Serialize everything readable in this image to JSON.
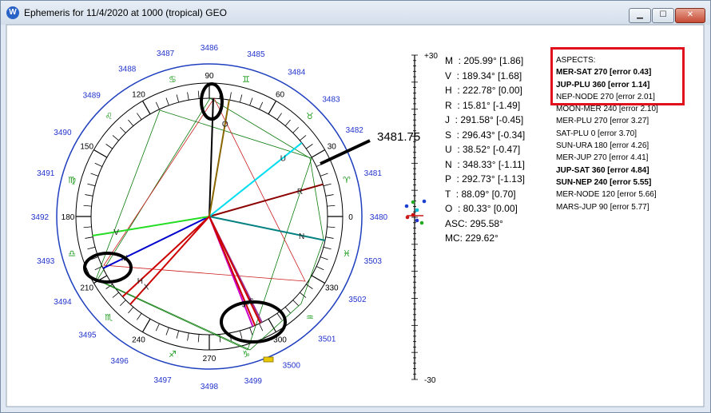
{
  "window": {
    "title": "Ephemeris for 11/4/2020 at 1000 (tropical) GEO",
    "app_icon": "W",
    "buttons": [
      "minimize",
      "maximize",
      "close"
    ]
  },
  "wheel": {
    "year_labels": [
      {
        "label": "3486",
        "angle": 90
      },
      {
        "label": "3485",
        "angle": 74
      },
      {
        "label": "3484",
        "angle": 59
      },
      {
        "label": "3483",
        "angle": 44
      },
      {
        "label": "3482",
        "angle": 31
      },
      {
        "label": "3481",
        "angle": 15
      },
      {
        "label": "3480",
        "angle": 0
      },
      {
        "label": "3503",
        "angle": -15
      },
      {
        "label": "3502",
        "angle": -29
      },
      {
        "label": "3501",
        "angle": -46
      },
      {
        "label": "3500",
        "angle": -61
      },
      {
        "label": "3499",
        "angle": -75
      },
      {
        "label": "3498",
        "angle": -90
      },
      {
        "label": "3497",
        "angle": -106
      },
      {
        "label": "3496",
        "angle": -122
      },
      {
        "label": "3495",
        "angle": -136
      },
      {
        "label": "3494",
        "angle": -150
      },
      {
        "label": "3493",
        "angle": -165
      },
      {
        "label": "3492",
        "angle": 180
      },
      {
        "label": "3491",
        "angle": 165
      },
      {
        "label": "3490",
        "angle": 150
      },
      {
        "label": "3489",
        "angle": 134
      },
      {
        "label": "3488",
        "angle": 119
      },
      {
        "label": "3487",
        "angle": 105
      }
    ],
    "degree_labels": [
      {
        "label": "0",
        "angle": 0
      },
      {
        "label": "30",
        "angle": 30
      },
      {
        "label": "60",
        "angle": 60
      },
      {
        "label": "90",
        "angle": 90
      },
      {
        "label": "120",
        "angle": 120
      },
      {
        "label": "150",
        "angle": 150
      },
      {
        "label": "180",
        "angle": 180
      },
      {
        "label": "210",
        "angle": 210
      },
      {
        "label": "240",
        "angle": 240
      },
      {
        "label": "270",
        "angle": 270
      },
      {
        "label": "300",
        "angle": 300
      },
      {
        "label": "330",
        "angle": 330
      }
    ],
    "sign_glyphs": [
      "♈",
      "♉",
      "♊",
      "♋",
      "♌",
      "♍",
      "♎",
      "♏",
      "♐",
      "♑",
      "♒",
      "♓"
    ],
    "sign_color": "#1a9a1a",
    "planets": [
      {
        "letter": "M",
        "deg": 205.99,
        "color": "#0000cc"
      },
      {
        "letter": "V",
        "deg": 189.34,
        "color": "#22dd22"
      },
      {
        "letter": "H",
        "deg": 222.78,
        "color": "#cc0000"
      },
      {
        "letter": "R",
        "deg": 15.81,
        "color": "#8b0000"
      },
      {
        "letter": "J",
        "deg": 291.58,
        "color": "#cc00cc"
      },
      {
        "letter": "S",
        "deg": 296.43,
        "color": "#993399"
      },
      {
        "letter": "U",
        "deg": 38.52,
        "color": "#00ddee"
      },
      {
        "letter": "N",
        "deg": 348.33,
        "color": "#008080"
      },
      {
        "letter": "P",
        "deg": 292.73,
        "color": "#cc0000"
      },
      {
        "letter": "T",
        "deg": 88.09,
        "color": "#000000"
      },
      {
        "letter": "O",
        "deg": 80.33,
        "color": "#886600"
      },
      {
        "letter": "X",
        "deg": 228.0,
        "color": "#cc0000"
      },
      {
        "letter": "A",
        "deg": 295.58,
        "color": "#cc0000"
      }
    ],
    "callout_label": "3481.75"
  },
  "scale": {
    "top_label": "+30",
    "bottom_label": "-30"
  },
  "readout": [
    "M  : 205.99° [1.86]",
    "V  : 189.34° [1.68]",
    "H  : 222.78° [0.00]",
    "R  : 15.81° [-1.49]",
    "J  : 291.58° [-0.45]",
    "S  : 296.43° [-0.34]",
    "U  : 38.52° [-0.47]",
    "N  : 348.33° [-1.11]",
    "P  : 292.73° [-1.13]",
    "T  : 88.09° [0.70]",
    "O  : 80.33° [0.00]",
    "ASC: 295.58°",
    "MC: 229.62°"
  ],
  "aspects": {
    "header": "ASPECTS:",
    "items": [
      {
        "text": "MER-SAT 270 [error 0.43]",
        "bold": true
      },
      {
        "text": "JUP-PLU 360 [error 1.14]",
        "bold": true
      },
      {
        "text": "NEP-NODE 270 [error 2.01]",
        "bold": false
      },
      {
        "text": "MOON-MER 240 [error 2.10]",
        "bold": false
      },
      {
        "text": "MER-PLU 270 [error 3.27]",
        "bold": false
      },
      {
        "text": "SAT-PLU 0 [error 3.70]",
        "bold": false
      },
      {
        "text": "SUN-URA 180 [error 4.26]",
        "bold": false
      },
      {
        "text": "MER-JUP 270 [error 4.41]",
        "bold": false
      },
      {
        "text": "JUP-SAT 360 [error 4.84]",
        "bold": true
      },
      {
        "text": "SUN-NEP 240 [error 5.55]",
        "bold": true
      },
      {
        "text": "MER-NODE 120 [error 5.66]",
        "bold": false
      },
      {
        "text": "MARS-JUP 90 [error 5.77]",
        "bold": false
      }
    ]
  }
}
